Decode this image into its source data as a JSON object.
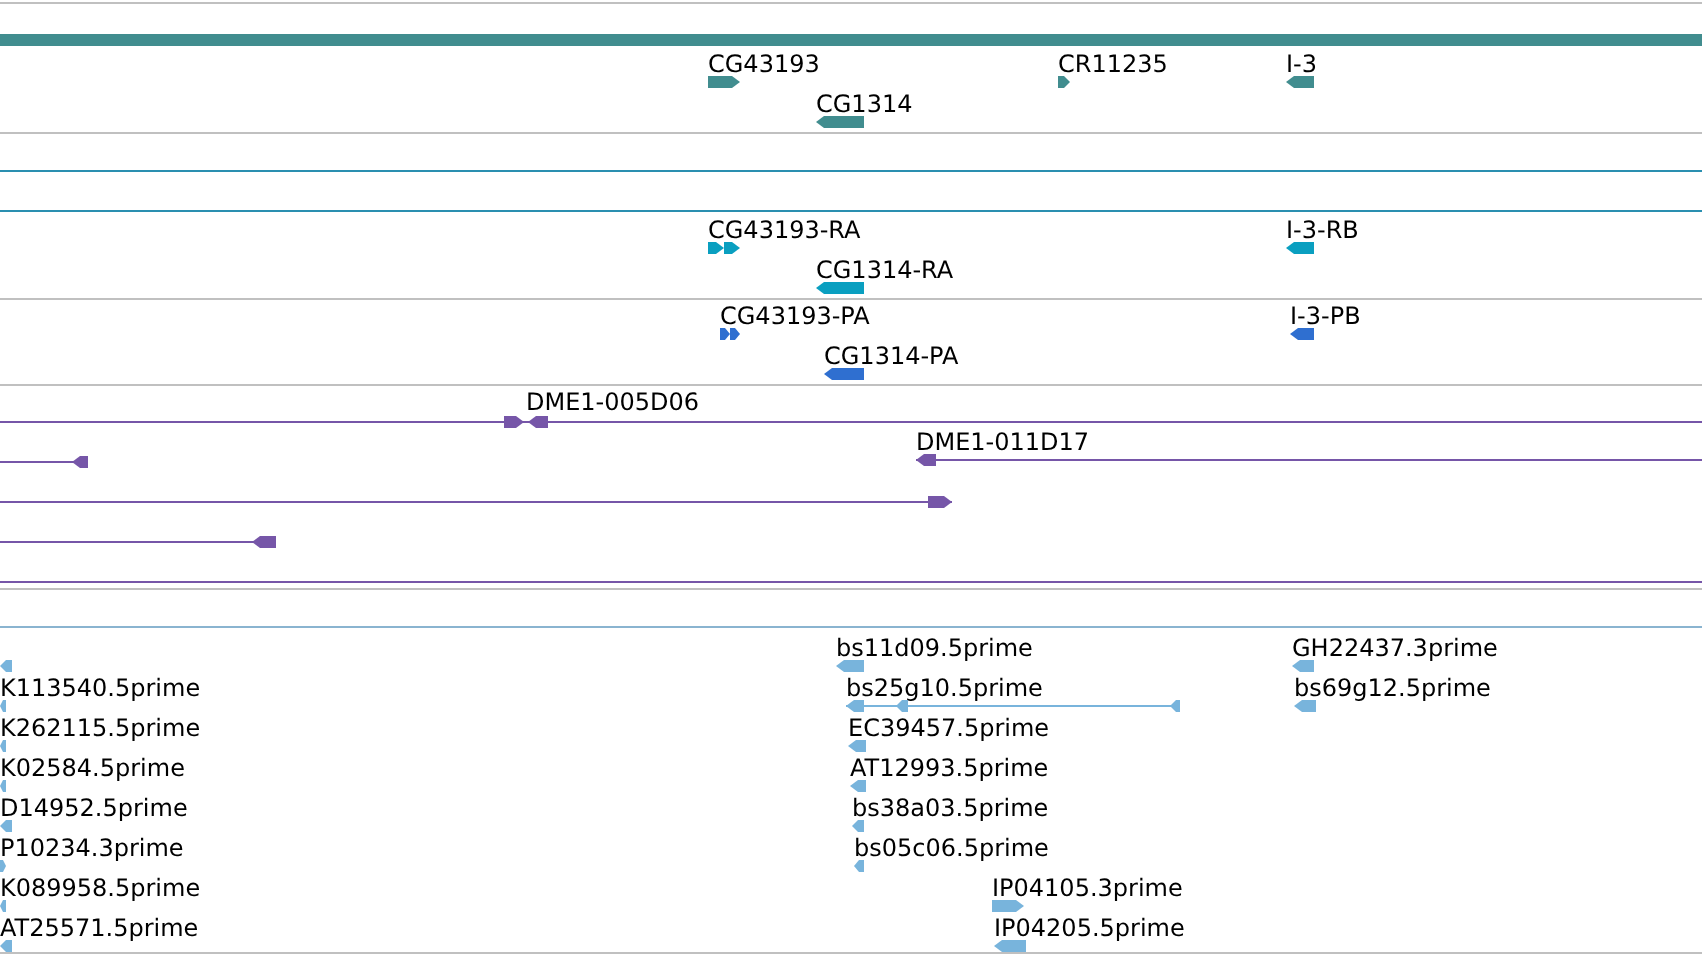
{
  "tracks": [
    {
      "kind": "gene",
      "color": "#418d8f",
      "features": [
        {
          "label": "CG43193",
          "kind": "forward"
        },
        {
          "label": "CG1314",
          "kind": "reverse"
        },
        {
          "label": "CR11235",
          "kind": "forward"
        },
        {
          "label": "I-3",
          "kind": "reverse"
        }
      ]
    },
    {
      "kind": "transcript",
      "color": "#0a9fc0",
      "features": [
        {
          "label": "CG43193-RA",
          "kind": "forward"
        },
        {
          "label": "CG1314-RA",
          "kind": "reverse"
        },
        {
          "label": "I-3-RB",
          "kind": "reverse"
        }
      ]
    },
    {
      "kind": "protein",
      "color": "#2f6fd0",
      "features": [
        {
          "label": "CG43193-PA",
          "kind": "forward"
        },
        {
          "label": "CG1314-PA",
          "kind": "reverse"
        },
        {
          "label": "I-3-PB",
          "kind": "reverse"
        }
      ]
    },
    {
      "kind": "clone",
      "color": "#7656a8",
      "features": [
        {
          "label": "DME1-005D06",
          "kind": "pair"
        },
        {
          "kind": "reverse"
        },
        {
          "label": "DME1-011D17",
          "kind": "reverse"
        },
        {
          "kind": "forward"
        },
        {
          "kind": "reverse"
        },
        {
          "kind": "line"
        }
      ]
    },
    {
      "kind": "est",
      "color": "#78b4dc",
      "features": [
        {
          "kind": "reverse"
        },
        {
          "label": "K113540.5prime",
          "kind": "reverse"
        },
        {
          "label": "K262115.5prime",
          "kind": "reverse"
        },
        {
          "label": "K02584.5prime",
          "kind": "reverse"
        },
        {
          "label": "D14952.5prime",
          "kind": "reverse"
        },
        {
          "label": "P10234.3prime",
          "kind": "forward"
        },
        {
          "label": "K089958.5prime",
          "kind": "reverse"
        },
        {
          "label": "AT25571.5prime",
          "kind": "reverse"
        },
        {
          "label": "bs11d09.5prime",
          "kind": "reverse"
        },
        {
          "label": "bs25g10.5prime",
          "kind": "reverse"
        },
        {
          "label": "EC39457.5prime",
          "kind": "reverse"
        },
        {
          "label": "AT12993.5prime",
          "kind": "reverse"
        },
        {
          "label": "bs38a03.5prime",
          "kind": "reverse"
        },
        {
          "label": "bs05c06.5prime",
          "kind": "reverse"
        },
        {
          "label": "IP04105.3prime",
          "kind": "forward"
        },
        {
          "label": "IP04205.5prime",
          "kind": "reverse"
        },
        {
          "label": "GH22437.3prime",
          "kind": "reverse"
        },
        {
          "label": "bs69g12.5prime",
          "kind": "reverse"
        }
      ]
    }
  ]
}
